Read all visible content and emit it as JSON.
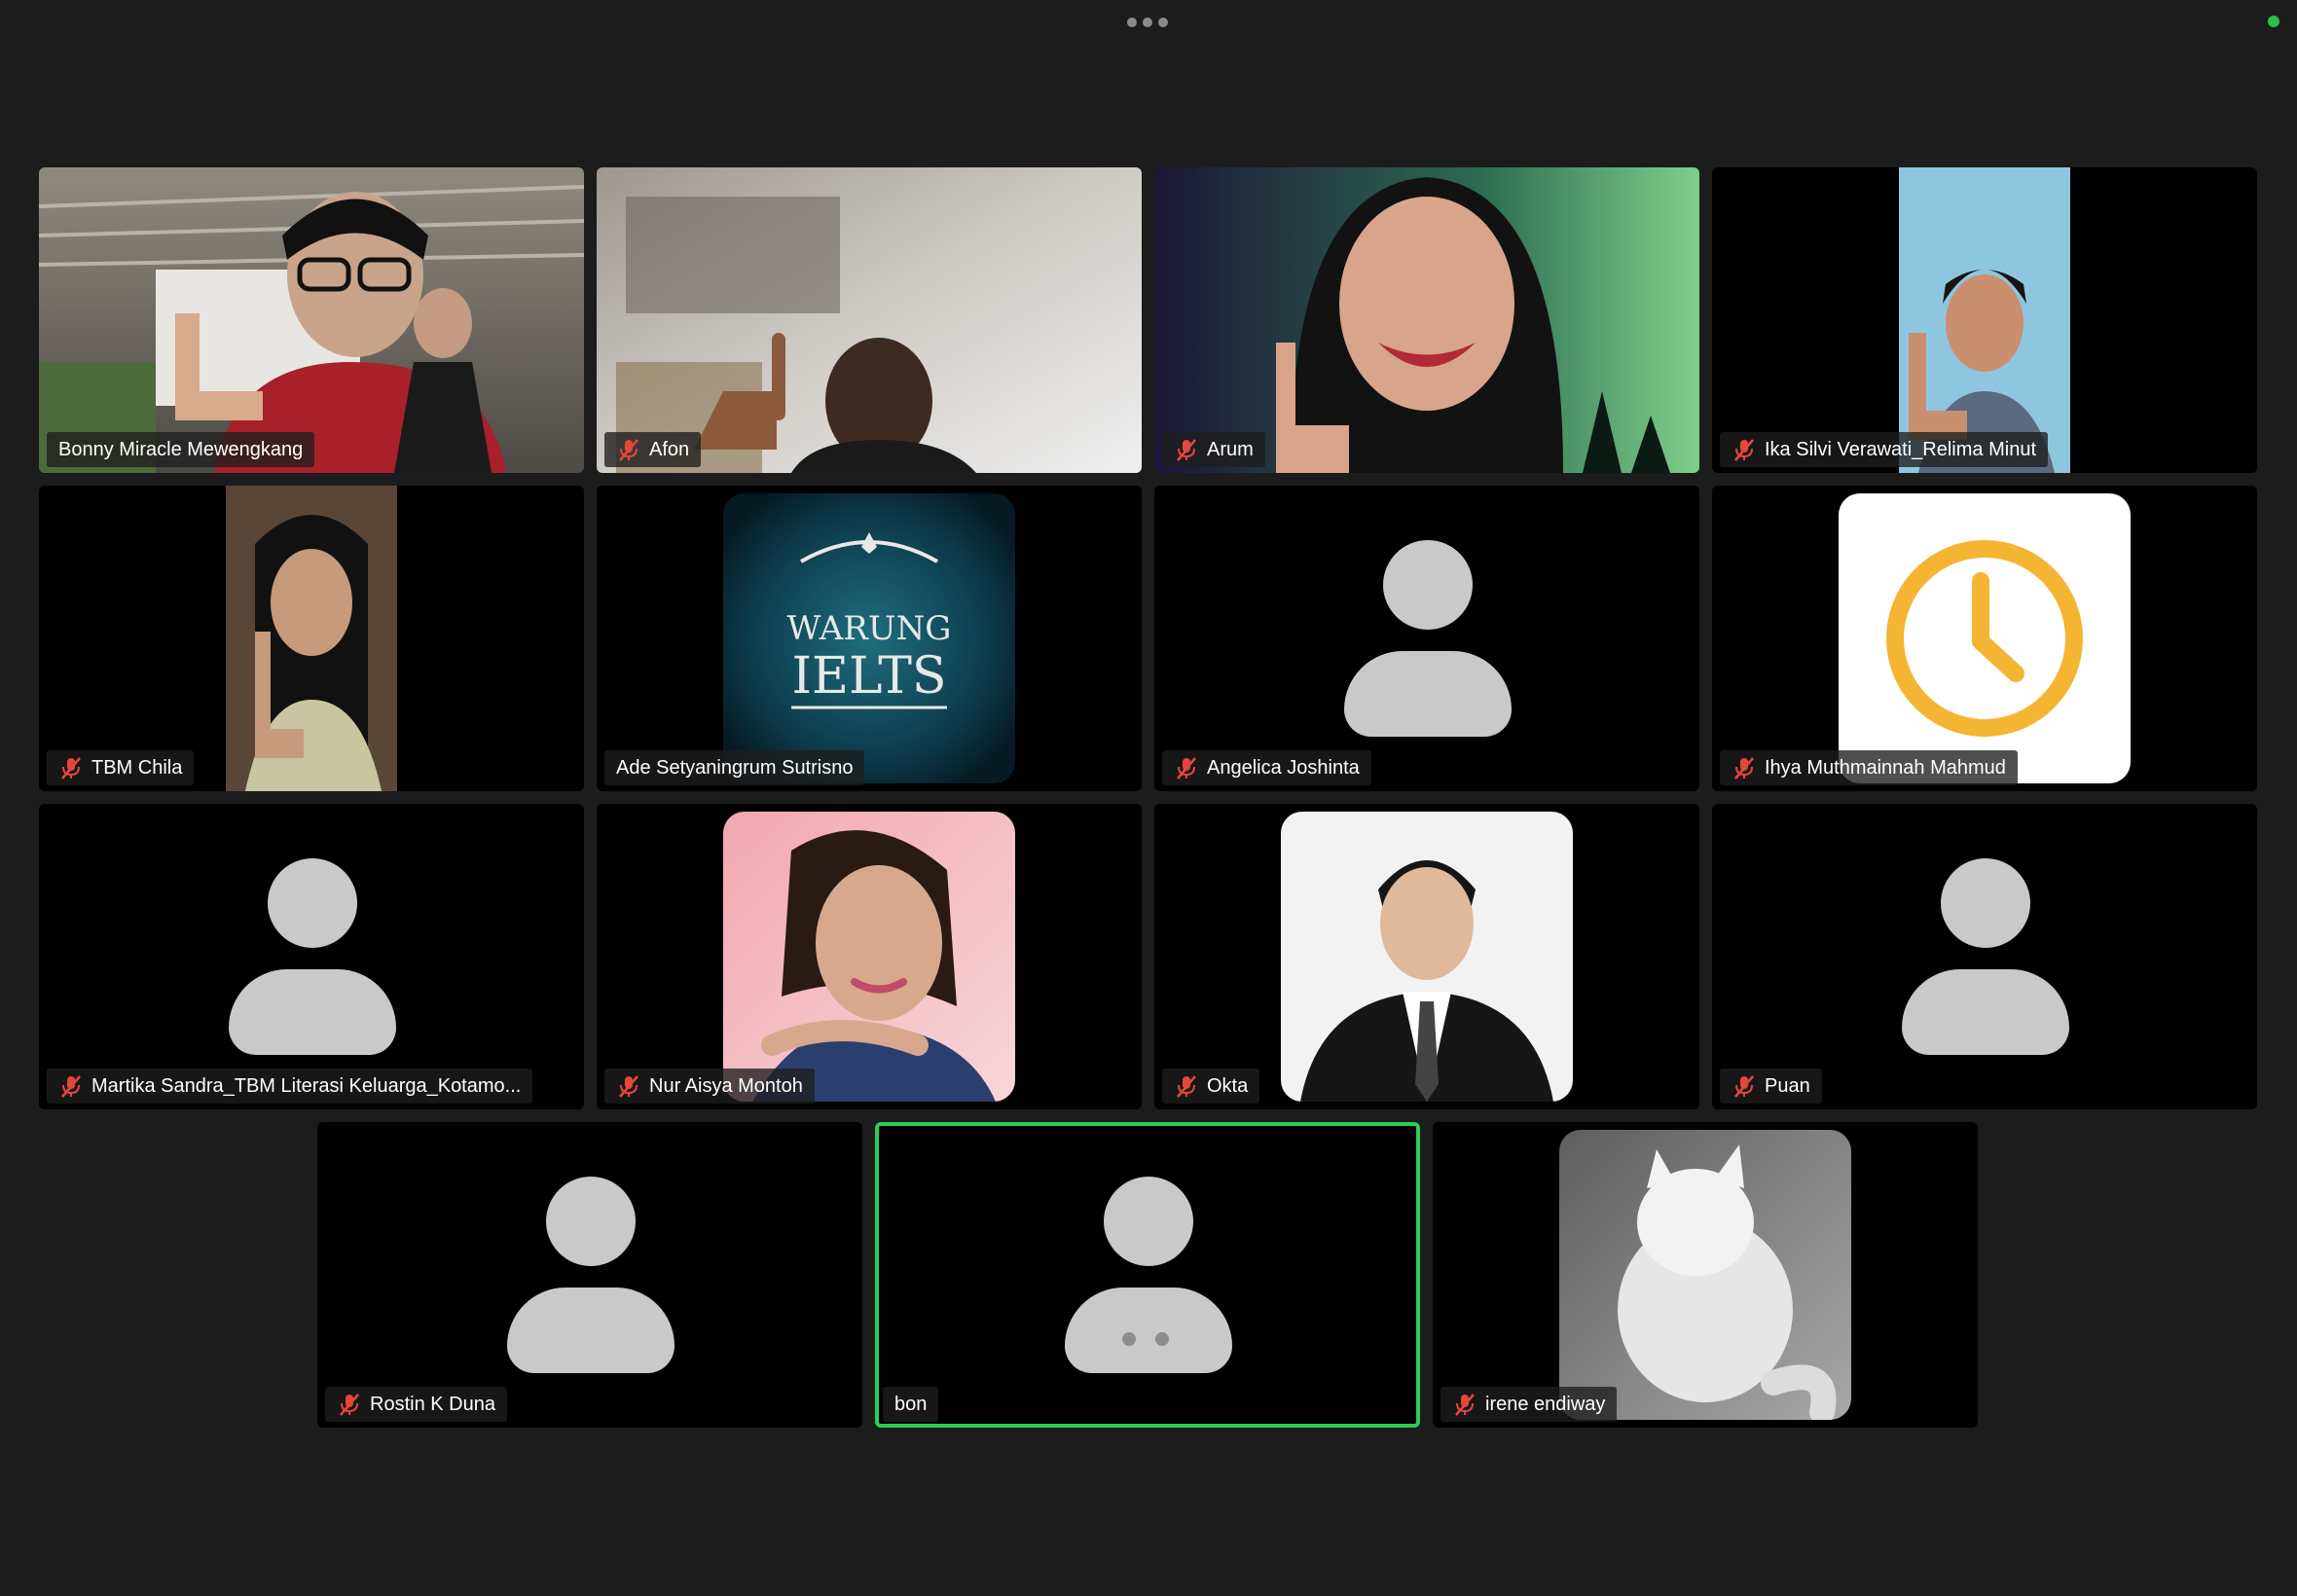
{
  "window": {
    "more_options_icon": "ellipsis-icon",
    "status_color": "#27c24c"
  },
  "active_speaker_border": "#2ecc55",
  "participants": [
    {
      "name": "Bonny Miracle Mewengkang",
      "muted": false,
      "video": "camera",
      "active": false
    },
    {
      "name": "Afon",
      "muted": true,
      "video": "camera",
      "active": false
    },
    {
      "name": "Arum",
      "muted": true,
      "video": "camera",
      "active": false
    },
    {
      "name": "Ika Silvi Verawati_Relima Minut",
      "muted": true,
      "video": "camera",
      "active": false
    },
    {
      "name": "TBM Chila",
      "muted": true,
      "video": "camera",
      "active": false
    },
    {
      "name": "Ade Setyaningrum Sutrisno",
      "muted": false,
      "video": "profile-picture",
      "active": false,
      "logo_text": {
        "line1": "WARUNG",
        "line2": "IELTS"
      }
    },
    {
      "name": "Angelica Joshinta",
      "muted": true,
      "video": "none",
      "active": false
    },
    {
      "name": "Ihya Muthmainnah Mahmud",
      "muted": true,
      "video": "profile-picture",
      "active": false
    },
    {
      "name": "Martika Sandra_TBM Literasi Keluarga_Kotamo...",
      "muted": true,
      "video": "none",
      "active": false
    },
    {
      "name": "Nur Aisya Montoh",
      "muted": true,
      "video": "profile-picture",
      "active": false
    },
    {
      "name": "Okta",
      "muted": true,
      "video": "profile-picture",
      "active": false
    },
    {
      "name": "Puan",
      "muted": true,
      "video": "none",
      "active": false
    },
    {
      "name": "Rostin K Duna",
      "muted": true,
      "video": "none",
      "active": false
    },
    {
      "name": "bon",
      "muted": false,
      "video": "none",
      "active": true
    },
    {
      "name": "irene endiway",
      "muted": true,
      "video": "profile-picture",
      "active": false
    }
  ],
  "icons": {
    "muted_mic": "muted-microphone-icon",
    "avatar": "default-avatar-icon"
  },
  "colors": {
    "background": "#1c1c1c",
    "tile": "#000000",
    "muted_icon": "#e8463c",
    "clock": "#f4b533"
  }
}
